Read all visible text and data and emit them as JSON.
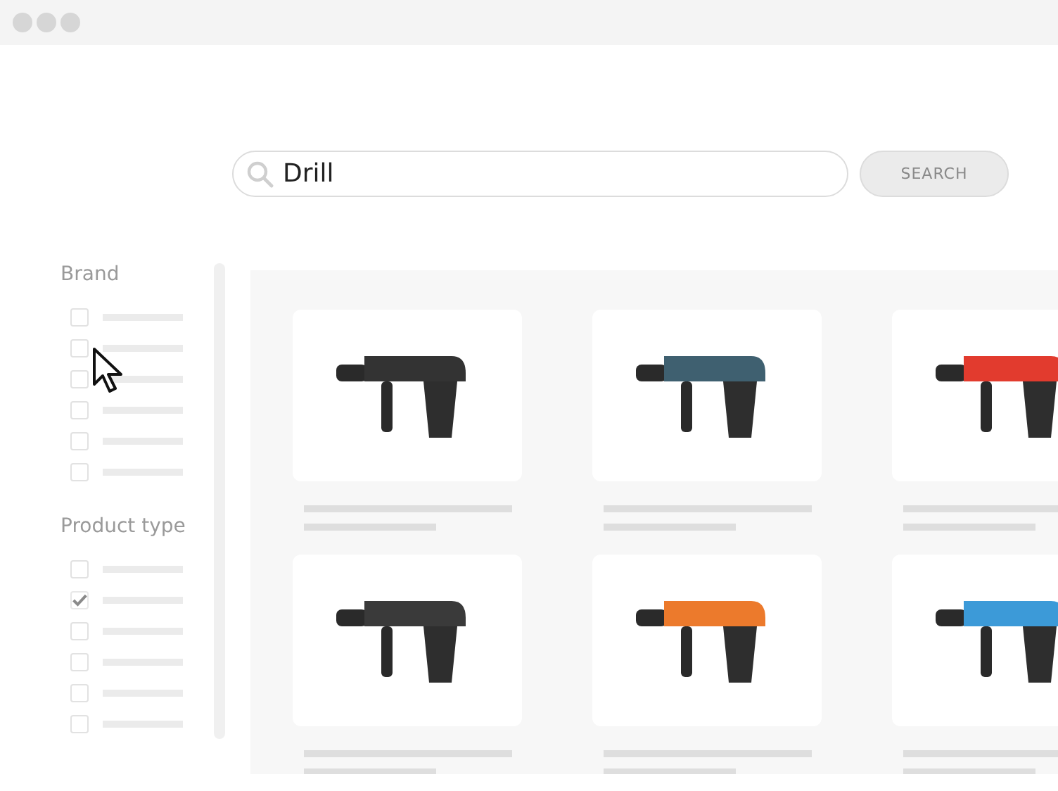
{
  "search": {
    "value": "Drill",
    "button": "SEARCH"
  },
  "filters": [
    {
      "title": "Brand",
      "options": [
        {
          "checked": false
        },
        {
          "checked": false
        },
        {
          "checked": false
        },
        {
          "checked": false
        },
        {
          "checked": false
        },
        {
          "checked": false
        }
      ]
    },
    {
      "title": "Product type",
      "options": [
        {
          "checked": false
        },
        {
          "checked": true
        },
        {
          "checked": false
        },
        {
          "checked": false
        },
        {
          "checked": false
        },
        {
          "checked": false
        }
      ]
    }
  ],
  "products": [
    {
      "color": "#333333"
    },
    {
      "color": "#3f6070"
    },
    {
      "color": "#e23b2e"
    },
    {
      "color": "#3a3a3a"
    },
    {
      "color": "#ec7a2c"
    },
    {
      "color": "#3c9ad8"
    }
  ]
}
